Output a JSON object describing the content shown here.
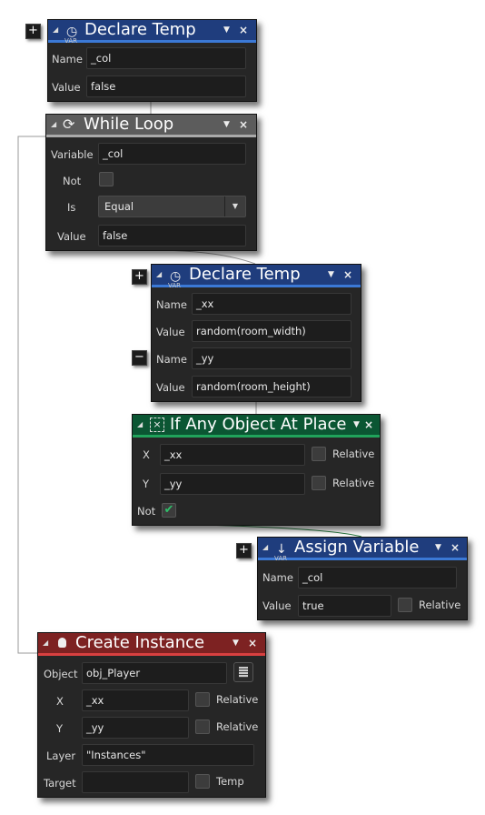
{
  "colors": {
    "declare": "#1f3d7d",
    "declare_line": "#3b79d6",
    "while": "#5c5c5c",
    "while_line": "#a9a9a9",
    "ifobj": "#0b5633",
    "ifobj_line": "#20a35b",
    "create": "#7d2222",
    "create_line": "#d84040",
    "check": "#2fbf6a"
  },
  "blocks": {
    "declare1": {
      "title": "Declare Temp",
      "icon": "stopwatch-var-icon",
      "rows": [
        {
          "label": "Name",
          "value": "_col"
        },
        {
          "label": "Value",
          "value": "false"
        }
      ]
    },
    "while": {
      "title": "While Loop",
      "icon": "loop-icon",
      "variable_label": "Variable",
      "variable": "_col",
      "not_label": "Not",
      "not_checked": false,
      "is_label": "Is",
      "is_value": "Equal",
      "value_label": "Value",
      "value": "false"
    },
    "declare2": {
      "title": "Declare Temp",
      "icon": "stopwatch-var-icon",
      "rows": [
        {
          "label": "Name",
          "value": "_xx"
        },
        {
          "label": "Value",
          "value": "random(room_width)"
        },
        {
          "label": "Name",
          "value": "_yy"
        },
        {
          "label": "Value",
          "value": "random(room_height)"
        }
      ]
    },
    "ifobj": {
      "title": "If Any Object At Place",
      "icon": "place-icon",
      "x_label": "X",
      "x": "_xx",
      "y_label": "Y",
      "y": "_yy",
      "relative": "Relative",
      "not_label": "Not",
      "not_checked": true
    },
    "assign": {
      "title": "Assign Variable",
      "icon": "assign-var-icon",
      "name_label": "Name",
      "name": "_col",
      "value_label": "Value",
      "value": "true",
      "relative": "Relative"
    },
    "create": {
      "title": "Create Instance",
      "icon": "lightbulb-icon",
      "object_label": "Object",
      "object": "obj_Player",
      "x_label": "X",
      "x": "_xx",
      "y_label": "Y",
      "y": "_yy",
      "relative": "Relative",
      "layer_label": "Layer",
      "layer": "\"Instances\"",
      "target_label": "Target",
      "target": "",
      "temp": "Temp"
    }
  },
  "var_tag": "VAR",
  "symbols": {
    "plus": "+",
    "minus": "−",
    "collapse": "◢",
    "dropdown": "▼",
    "close": "×"
  }
}
